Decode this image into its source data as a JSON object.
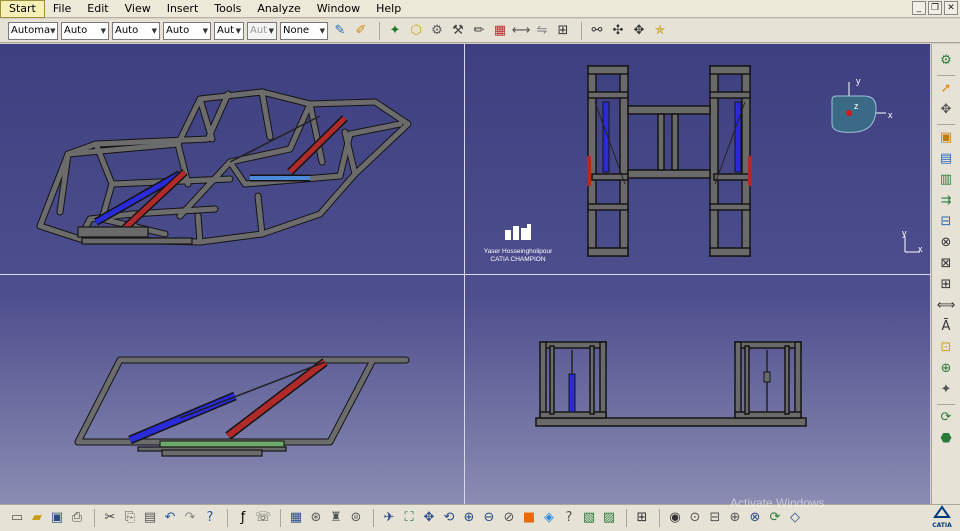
{
  "menubar": {
    "items": [
      "Start",
      "File",
      "Edit",
      "View",
      "Insert",
      "Tools",
      "Analyze",
      "Window",
      "Help"
    ],
    "active": "Start",
    "window_controls": [
      "_",
      "❐",
      "✕"
    ]
  },
  "toolbar": {
    "selects": [
      {
        "value": "Automa",
        "disabled": false
      },
      {
        "value": "Auto",
        "disabled": false
      },
      {
        "value": "Auto",
        "disabled": false
      },
      {
        "value": "Auto",
        "disabled": false
      },
      {
        "value": "Aut",
        "disabled": false
      },
      {
        "value": "Aut",
        "disabled": true
      },
      {
        "value": "None",
        "disabled": false
      }
    ],
    "icons": [
      "painter-icon",
      "format-brush-icon",
      "catalog-icon",
      "part-body-icon",
      "assembly-icon",
      "constraints-icon",
      "sketch-icon",
      "analysis-icon",
      "measure-icon",
      "swap-icon",
      "grid-icon",
      "snap-icon",
      "explode-icon",
      "compass-icon"
    ]
  },
  "viewport": {
    "logo_name": "Yaser Hosseingholipour",
    "logo_sub": "CATIA CHAMPION",
    "compass": {
      "x": "x",
      "y": "y",
      "z": "z"
    },
    "view_axis": {
      "x": "x",
      "y": "y"
    }
  },
  "rightbar": {
    "icons": [
      "sketcher-icon",
      "select-arrow-icon",
      "drafting-icon",
      "view-layout-icon",
      "front-view-icon",
      "projection-view-icon",
      "auxiliary-view-icon",
      "section-view-icon",
      "detail-view-icon",
      "clipping-view-icon",
      "break-view-icon",
      "dimensioning-icon",
      "annotation-text-icon",
      "table-icon",
      "balloon-icon",
      "generate-dimension-icon",
      "update-icon",
      "geometry-icon"
    ]
  },
  "bottombar": {
    "icons": [
      "new-icon",
      "open-icon",
      "save-icon",
      "print-icon",
      "cut-icon",
      "copy-icon",
      "paste-icon",
      "undo-icon",
      "redo-icon",
      "whats-this-icon",
      "formula-icon",
      "comment-icon",
      "table-icon",
      "catalog-icon",
      "knowledge-icon",
      "publish-icon",
      "fly-mode-icon",
      "fit-all-icon",
      "pan-icon",
      "rotate-icon",
      "zoom-in-icon",
      "zoom-out-icon",
      "normal-view-icon",
      "iso-view-icon",
      "view-mode-icon",
      "hide-show-icon",
      "swap-space-icon",
      "manipulate-icon",
      "capture-icon",
      "lighting-icon",
      "depth-effect-icon",
      "ground-icon",
      "magnifier-icon",
      "analysis-icon",
      "catia-logo-icon"
    ],
    "watermark": "Activate Windows",
    "brand": "CATIA"
  },
  "colors": {
    "background_top": "#3e3f80",
    "background_bottom": "#8a8cb2",
    "frame": "#6e6e6e",
    "cylinder_blue": "#2a2ad8",
    "cylinder_red": "#b02a2a",
    "compass": "#3b6a86"
  }
}
